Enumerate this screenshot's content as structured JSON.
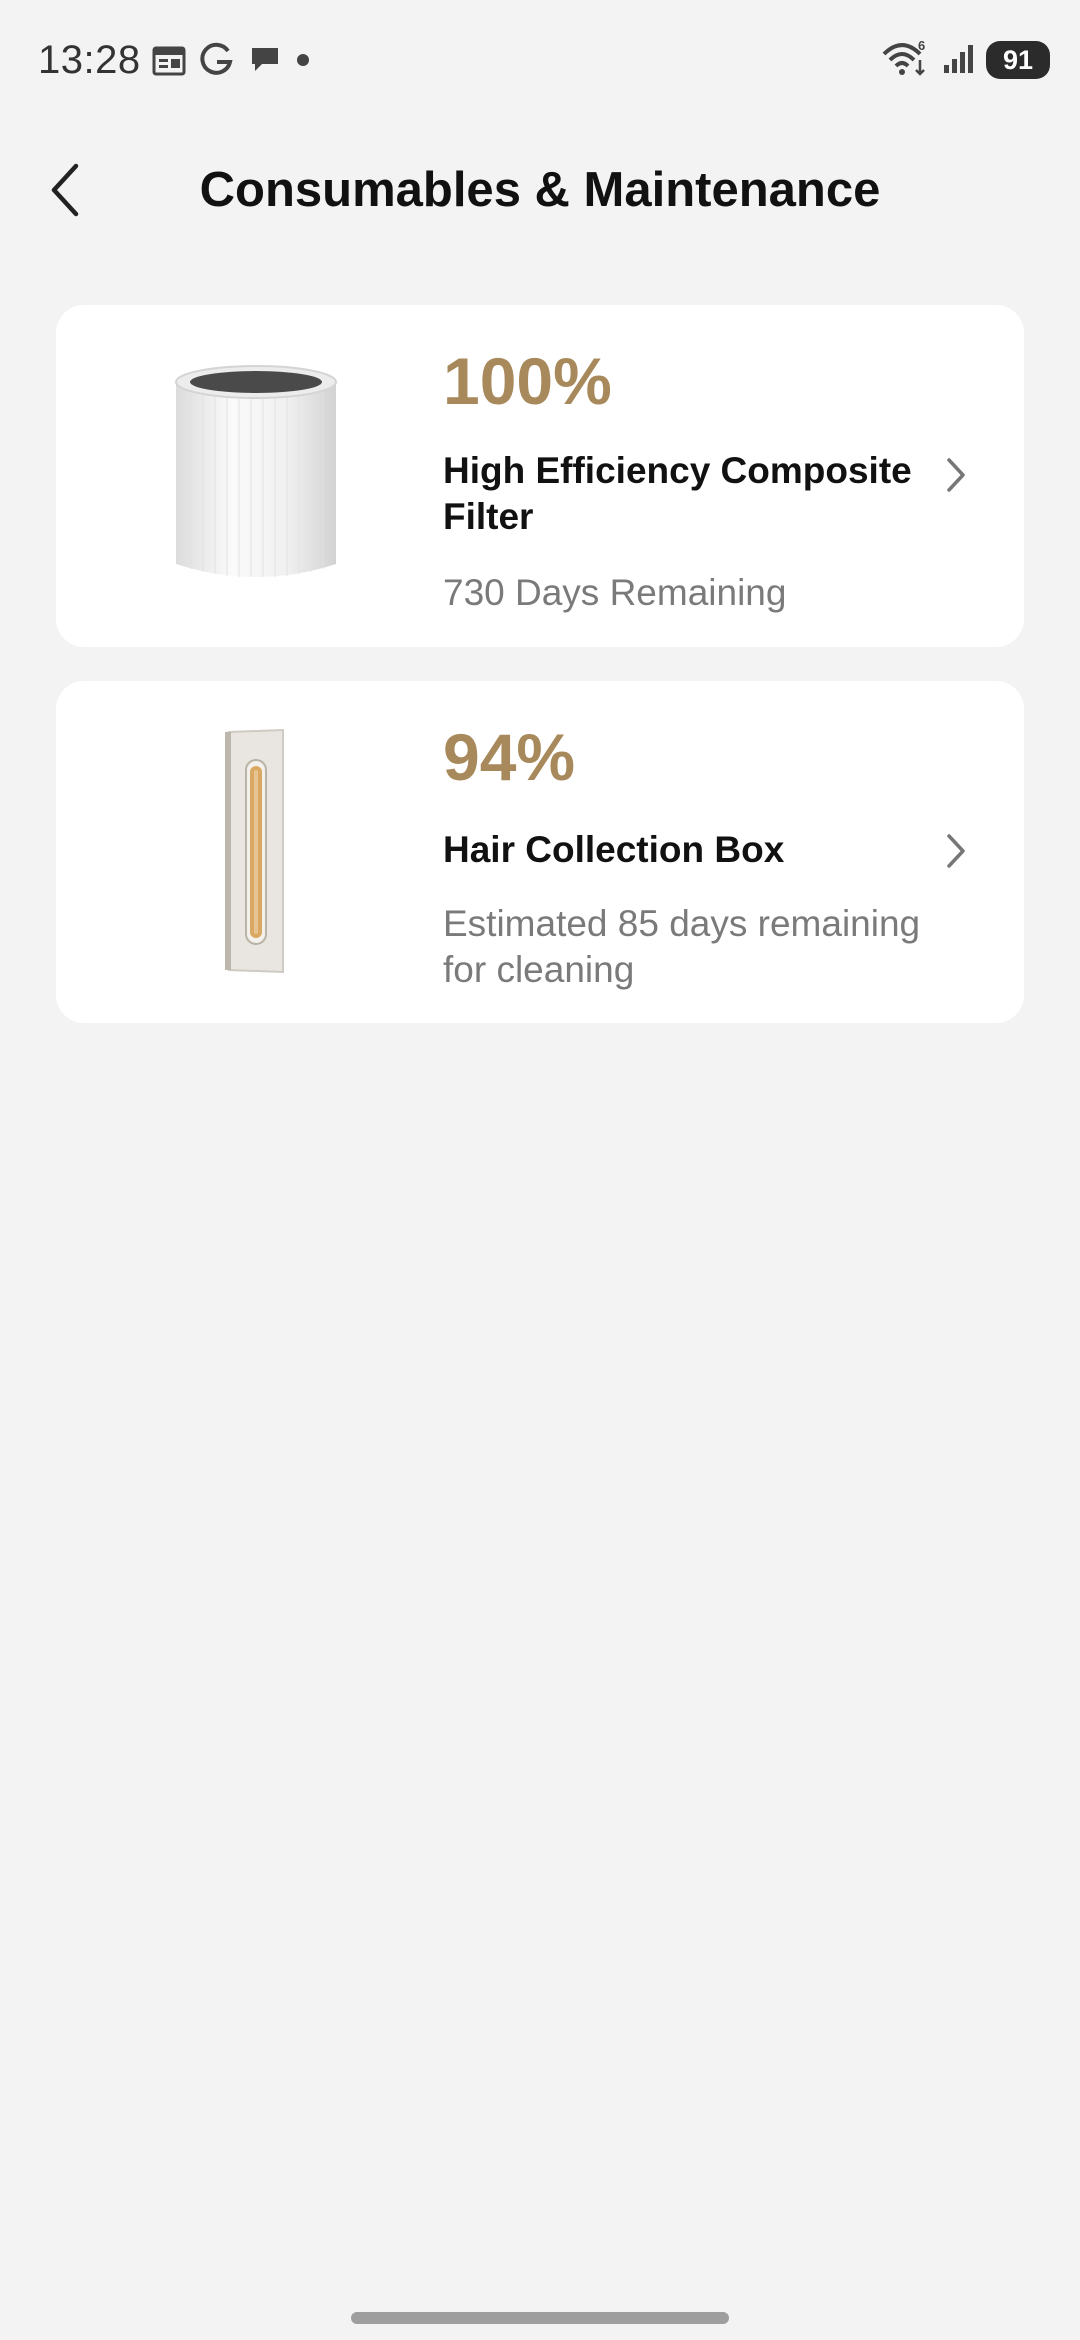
{
  "status_bar": {
    "time": "13:28",
    "battery": "91",
    "icons": [
      "calendar-icon",
      "g-logo-icon",
      "chat-bubble-icon",
      "dot-icon",
      "wifi-icon",
      "signal-icon",
      "battery-icon"
    ]
  },
  "header": {
    "title": "Consumables & Maintenance",
    "back_icon": "chevron-left-icon"
  },
  "consumables": [
    {
      "percent": "100%",
      "name": "High Efficiency Composite Filter",
      "status": "730 Days Remaining",
      "image": "filter-image"
    },
    {
      "percent": "94%",
      "name": "Hair Collection Box",
      "status": "Estimated 85 days remaining for cleaning",
      "image": "hair-box-image"
    }
  ],
  "colors": {
    "accent": "#a8895b",
    "background": "#f3f3f3",
    "card": "#ffffff",
    "secondary_text": "#7a7a7a"
  }
}
